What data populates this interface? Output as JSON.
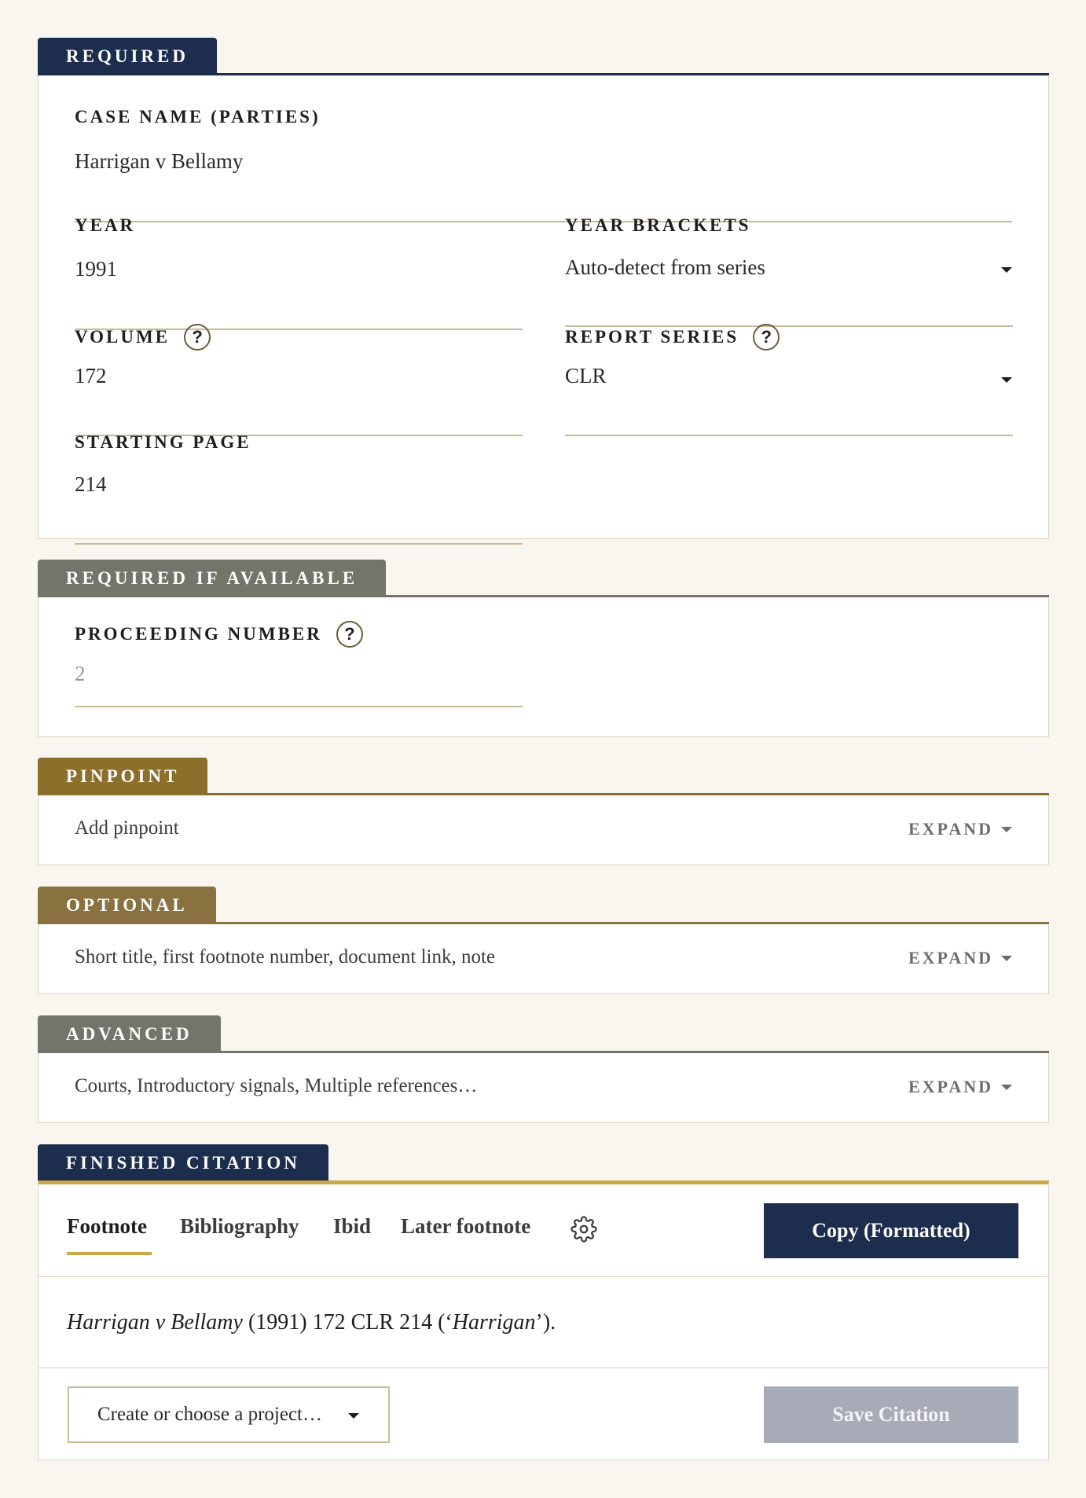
{
  "required": {
    "tab_label": "REQUIRED",
    "case_name": {
      "label": "CASE NAME (PARTIES)",
      "value": "Harrigan v Bellamy"
    },
    "year": {
      "label": "YEAR",
      "value": "1991"
    },
    "year_brackets": {
      "label": "YEAR BRACKETS",
      "value": "Auto-detect from series"
    },
    "volume": {
      "label": "VOLUME",
      "value": "172",
      "help": "?"
    },
    "report_series": {
      "label": "REPORT SERIES",
      "value": "CLR",
      "help": "?"
    },
    "starting_page": {
      "label": "STARTING PAGE",
      "value": "214"
    }
  },
  "required_if_available": {
    "tab_label": "REQUIRED IF AVAILABLE",
    "proceeding_number": {
      "label": "PROCEEDING NUMBER",
      "placeholder": "2",
      "help": "?"
    }
  },
  "pinpoint": {
    "tab_label": "PINPOINT",
    "summary": "Add pinpoint",
    "expand_label": "EXPAND"
  },
  "optional": {
    "tab_label": "OPTIONAL",
    "summary": "Short title, first footnote number, document link, note",
    "expand_label": "EXPAND"
  },
  "advanced": {
    "tab_label": "ADVANCED",
    "summary": "Courts, Introductory signals, Multiple references…",
    "expand_label": "EXPAND"
  },
  "finished": {
    "tab_label": "FINISHED CITATION",
    "tabs": [
      "Footnote",
      "Bibliography",
      "Ibid",
      "Later footnote"
    ],
    "active_tab": "Footnote",
    "copy_button": "Copy (Formatted)",
    "citation": {
      "case_italic": "Harrigan v Bellamy",
      "middle": " (1991) 172 CLR 214 (‘",
      "short_italic": "Harrigan",
      "end": "’)."
    },
    "project_select": "Create or choose a project…",
    "save_button": "Save Citation"
  },
  "colors": {
    "navy": "#1c2d4e",
    "grey": "#73746a",
    "gold": "#8c6f2a",
    "optional_brown": "#8a7140",
    "accent_gold": "#c9a84a"
  },
  "icons": {
    "settings": "gear-icon",
    "help": "help-icon",
    "dropdown": "caret-down-icon"
  }
}
